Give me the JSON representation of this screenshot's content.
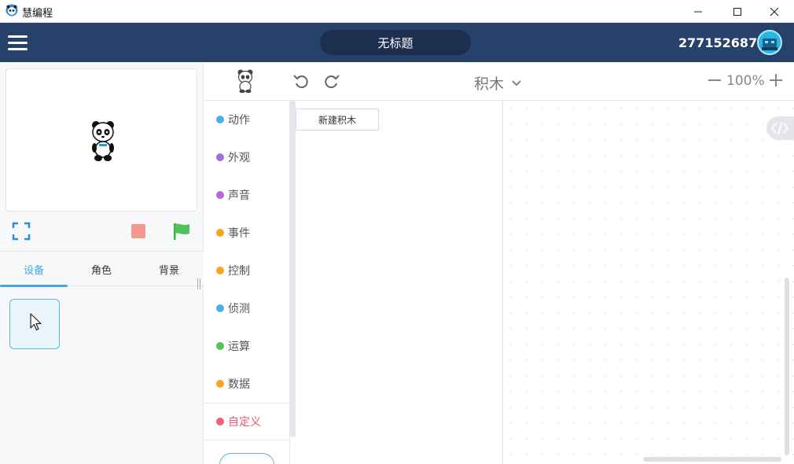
{
  "window": {
    "title": "慧编程"
  },
  "header": {
    "project_title": "无标题",
    "user_id": "277152687"
  },
  "stage_tabs": [
    "设备",
    "角色",
    "背景"
  ],
  "toolbar": {
    "mode_label": "积木",
    "zoom": "100%"
  },
  "categories": [
    {
      "label": "动作",
      "color": "#4cb0ef"
    },
    {
      "label": "外观",
      "color": "#a66fd1"
    },
    {
      "label": "声音",
      "color": "#b06bd6"
    },
    {
      "label": "事件",
      "color": "#f5a623"
    },
    {
      "label": "控制",
      "color": "#f5a623"
    },
    {
      "label": "侦测",
      "color": "#4cb0ef"
    },
    {
      "label": "运算",
      "color": "#5cc15c"
    },
    {
      "label": "数据",
      "color": "#f5a623"
    },
    {
      "label": "自定义",
      "color": "#f0607a"
    }
  ],
  "flyout": {
    "new_block_label": "新建积木"
  },
  "colors": {
    "accent": "#3fa9e0",
    "header_bg": "#26416a",
    "active_category": "#e9556e"
  }
}
